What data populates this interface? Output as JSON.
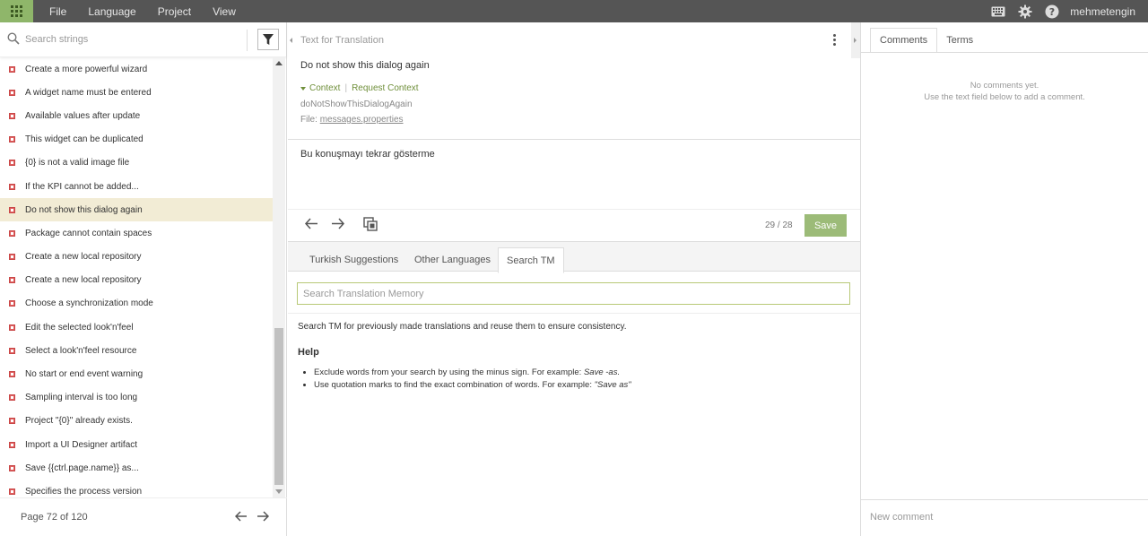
{
  "topbar": {
    "menu": [
      "File",
      "Language",
      "Project",
      "View"
    ],
    "username": "mehmetengin",
    "icons": [
      "apps-grid-icon",
      "keyboard-icon",
      "gear-icon",
      "help-icon"
    ]
  },
  "left": {
    "search_placeholder": "Search strings",
    "strings": [
      "Create a more powerful wizard",
      "A widget name must be entered",
      "Available values after update",
      "This widget can be duplicated",
      "{0} is not a valid image file",
      "If the KPI cannot be added...",
      "Do not show this dialog again",
      "Package cannot contain spaces",
      "Create a new local repository",
      "Create a new local repository",
      "Choose a synchronization mode",
      "Edit the selected look'n'feel",
      "Select a look'n'feel resource",
      "No start or end event warning",
      "Sampling interval is too long",
      "Project \"{0}\" already exists.",
      "Import a UI Designer artifact",
      "Save {{ctrl.page.name}} as...",
      "Specifies the process version"
    ],
    "selected_index": 6,
    "pager_label": "Page 72 of 120"
  },
  "center": {
    "header_title": "Text for Translation",
    "source_text": "Do not show this dialog again",
    "context_label": "Context",
    "request_context_label": "Request Context",
    "key": "doNotShowThisDialogAgain",
    "file_prefix": "File:",
    "file_name": "messages.properties",
    "translation": "Bu konuşmayı tekrar gösterme",
    "counter": "29 / 28",
    "save_label": "Save",
    "tabs": [
      "Turkish Suggestions",
      "Other Languages",
      "Search TM"
    ],
    "active_tab": 2,
    "tm_placeholder": "Search Translation Memory",
    "tm_description": "Search TM for previously made translations and reuse them to ensure consistency.",
    "help_title": "Help",
    "help_items": [
      {
        "text": "Exclude words from your search by using the minus sign. For example: ",
        "example": "Save -as."
      },
      {
        "text": "Use quotation marks to find the exact combination of words. For example: ",
        "example": "\"Save as\""
      }
    ]
  },
  "right": {
    "tabs": [
      "Comments",
      "Terms"
    ],
    "no_comments_line1": "No comments yet.",
    "no_comments_line2": "Use the text field below to add a comment.",
    "comment_placeholder": "New comment"
  },
  "colors": {
    "topbar": "#555555",
    "apps_button": "#8fb66a",
    "selected_row": "#f2ecd5",
    "save_button": "#9cbb78",
    "context_link": "#6f8f3a",
    "untranslated_flag": "#e06060"
  }
}
